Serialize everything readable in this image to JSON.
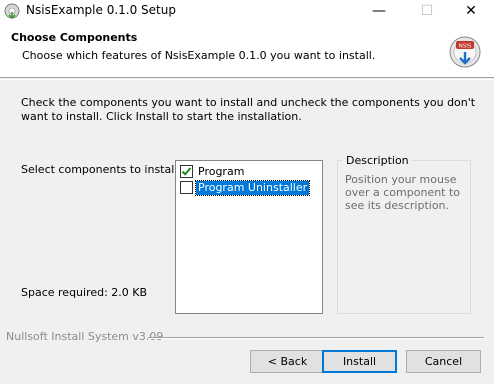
{
  "window": {
    "title": "NsisExample 0.1.0 Setup",
    "minimize_glyph": "—",
    "maximize_glyph": "☐",
    "close_glyph": "✕"
  },
  "header": {
    "title": "Choose Components",
    "subtitle": "Choose which features of NsisExample 0.1.0 you want to install.",
    "icon": "installer-disk-icon",
    "icon_badge_text": "NSIS"
  },
  "body": {
    "intro": "Check the components you want to install and uncheck the components you don't want to install. Click Install to start the installation.",
    "select_label": "Select components to install:",
    "space_required": "Space required: 2.0 KB"
  },
  "components": [
    {
      "label": "Program",
      "checked": true,
      "selected": false
    },
    {
      "label": "Program Uninstaller",
      "checked": false,
      "selected": true
    }
  ],
  "description": {
    "title": "Description",
    "text": "Position your mouse over a component to see its description."
  },
  "footer": {
    "brand": "Nullsoft Install System v3.09"
  },
  "buttons": {
    "back": "< Back",
    "install": "Install",
    "cancel": "Cancel"
  },
  "colors": {
    "selection": "#0078d7",
    "checkmark": "#1f8a1f",
    "disabled_text": "#6d6d6d"
  }
}
